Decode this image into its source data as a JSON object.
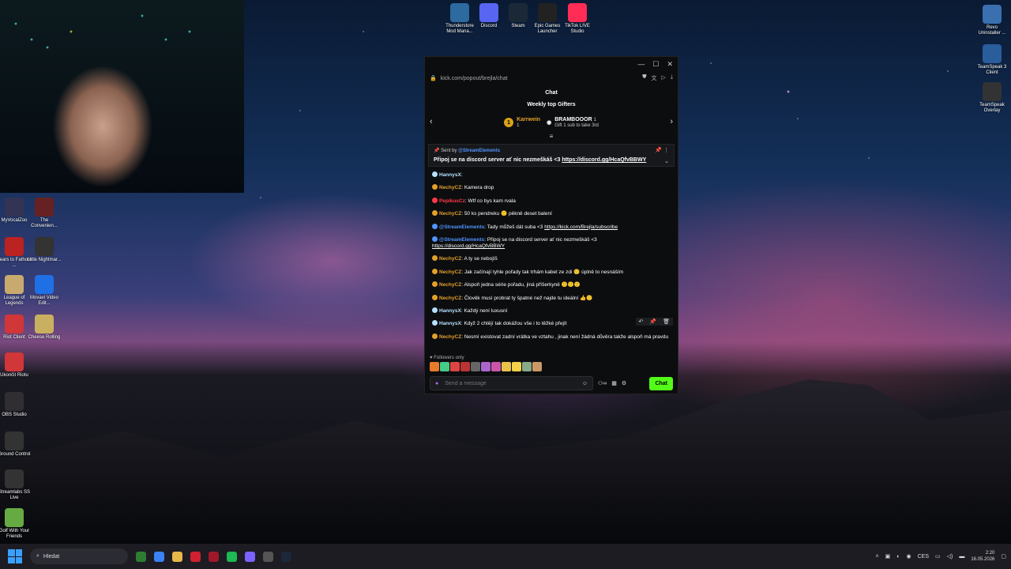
{
  "window": {
    "url": "kick.com/popout/brejla/chat",
    "chat_title": "Chat",
    "gifters_title": "Weekly top Gifters"
  },
  "gifters": [
    {
      "name": "Karrwein",
      "count": "1",
      "icon": "medal-1"
    },
    {
      "name": "BRAMBOOOR",
      "count": "1",
      "note": "Gift 1 sub to take 3rd"
    }
  ],
  "pinned": {
    "sent_by_label": "Sent by",
    "user": "@StreamElements",
    "message": "Připoj se na discord server ať nic nezmeškáš <3",
    "link": "https://discord.gg/HcaQfvBBWY"
  },
  "messages": [
    {
      "user": "HannysX",
      "text": "",
      "color": "#b5e0ff"
    },
    {
      "user": "NechyCZ",
      "text": "Kamera drop",
      "color": "#e2a02a"
    },
    {
      "user": "PepikusCz",
      "text": "Wtf co bys kam rvala",
      "color": "#ff3a4a"
    },
    {
      "user": "NechyCZ",
      "text": "50 ks pendreku 🙂 pěkně deset balení",
      "color": "#e2a02a"
    },
    {
      "user": "@StreamElements",
      "text": "Tady můžeš dát suba <3",
      "link": "https://kick.com/Brejla/subscribe",
      "color": "#4f95ff"
    },
    {
      "user": "@StreamElements",
      "text": "Připoj se na discord server ať nic nezmeškáš <3",
      "link": "https://discord.gg/HcaQfvBBWY",
      "color": "#4f95ff"
    },
    {
      "user": "NechyCZ",
      "text": "A ty se nebojíš",
      "color": "#e2a02a"
    },
    {
      "user": "NechyCZ",
      "text": "Jak začínají tyhle pořady tak trhám kabel ze zdi 🙂 úplně to nesnáším",
      "color": "#e2a02a"
    },
    {
      "user": "NechyCZ",
      "text": "Alspoň jedna série pořadu, jiná příšerkyně 🙂🙂🙂",
      "color": "#e2a02a"
    },
    {
      "user": "NechyCZ",
      "text": "Člověk musí probrat ty špatné než najde tu ideální 👍🙂",
      "color": "#e2a02a"
    },
    {
      "user": "HannysX",
      "text": "Každý není luxusní",
      "color": "#b5e0ff"
    },
    {
      "user": "HannysX",
      "text": "Když 2 chtějí tak dokážou vše i to těžké přejít",
      "color": "#b5e0ff"
    },
    {
      "user": "NechyCZ",
      "text": "Nesmí existovat zadní vrátka ve vztahu , jinak není žádná důvěra takže alspoň má pravdu",
      "color": "#e2a02a"
    }
  ],
  "footer": {
    "followers_only": "Followers only",
    "input_placeholder": "Send a message",
    "chat_button": "Chat"
  },
  "desktop_icons_top": [
    {
      "label": "Thunderstore Mod Mana...",
      "color": "#2c6aa0"
    },
    {
      "label": "Discord",
      "color": "#5865f2"
    },
    {
      "label": "Steam",
      "color": "#1b2838"
    },
    {
      "label": "Epic Games Launcher",
      "color": "#222"
    },
    {
      "label": "TikTok LIVE Studio",
      "color": "#ff2c55"
    }
  ],
  "desktop_icons_left": [
    {
      "label": "MyVocalZoo",
      "color": "#335"
    },
    {
      "label": "The Convenien...",
      "color": "#622"
    },
    {
      "label": "Fears to Fathom ...",
      "color": "#b22"
    },
    {
      "label": "Little Nightmar...",
      "color": "#333"
    },
    {
      "label": "League of Legends",
      "color": "#c8aa6e"
    },
    {
      "label": "Movavi Video Edit...",
      "color": "#1f6fe5"
    },
    {
      "label": "Riot Client",
      "color": "#d13639"
    },
    {
      "label": "Cheese Rolling",
      "color": "#c9b060"
    },
    {
      "label": "Ukončit Riotu",
      "color": "#d13639"
    },
    {
      "label": "OBS Studio",
      "color": "#302e31"
    },
    {
      "label": "Ground Control",
      "color": "#333"
    },
    {
      "label": "Streamlabs SS Live",
      "color": "#333"
    },
    {
      "label": "Golf With Your Friends",
      "color": "#6a4"
    }
  ],
  "desktop_icons_right": [
    {
      "label": "Revo Uninstaller ...",
      "color": "#3a6fb0"
    },
    {
      "label": "TeamSpeak 3 Client",
      "color": "#2b5c9c"
    },
    {
      "label": "TeamSpeak Overlay",
      "color": "#333"
    }
  ],
  "taskbar": {
    "search_placeholder": "Hledat",
    "lang": "CES",
    "time": "2:20",
    "date": "16.05.2026"
  }
}
